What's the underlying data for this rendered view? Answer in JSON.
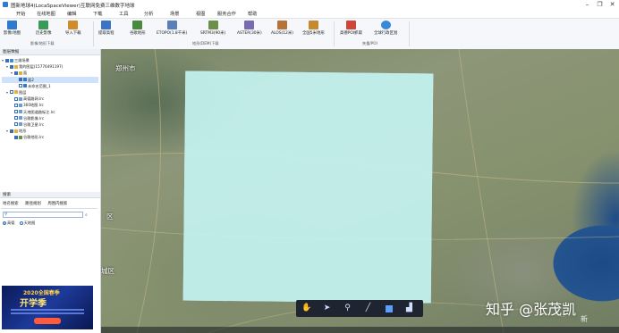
{
  "window": {
    "title": "图新地球4(LocaSpaceViewer)互联网免费三维数字地球",
    "controls": [
      "–",
      "❐",
      "✕"
    ]
  },
  "menu": [
    "开始",
    "在线地图",
    "编辑",
    "下载",
    "工具",
    "分析",
    "场景",
    "视图",
    "服务合作",
    "帮助"
  ],
  "ribbon": {
    "buttons": [
      {
        "label": "影像/地图",
        "icon": "imagery-icon",
        "color": "#2f7ad1"
      },
      {
        "label": "历史影像",
        "icon": "history-imagery-icon",
        "color": "#3a9a57"
      },
      {
        "label": "导入下载",
        "icon": "import-download-icon",
        "color": "#d08b2a"
      },
      {
        "label": "提取高程",
        "icon": "extract-elevation-icon",
        "color": "#3c73c4"
      },
      {
        "label": "谷歌地形",
        "icon": "google-terrain-icon",
        "color": "#4a8a3c"
      },
      {
        "label": "ETOPO(1.8千米)",
        "icon": "etopo-icon",
        "color": "#5b7fb8"
      },
      {
        "label": "SRTM3(90米)",
        "icon": "srtm3-icon",
        "color": "#6c8f4a"
      },
      {
        "label": "ASTER(30米)",
        "icon": "aster-icon",
        "color": "#7a6bb0"
      },
      {
        "label": "ALOS(12米)",
        "icon": "alos-icon",
        "color": "#b5733a"
      },
      {
        "label": "全国5米地形",
        "icon": "terrain-5m-icon",
        "color": "#c58a2e"
      },
      {
        "label": "高德POI抓取",
        "icon": "amap-poi-icon",
        "color": "#d0453a"
      },
      {
        "label": "全球行政区划",
        "icon": "admin-boundary-icon",
        "color": "#3b88d6"
      }
    ],
    "groups": [
      "影像/地形下载",
      "地形(DEM)下载",
      "矢量/POI"
    ]
  },
  "layers_panel": {
    "title": "图层数据",
    "rows": [
      {
        "label": "三维场景",
        "level": 0,
        "checked": true,
        "toggle": "▾"
      },
      {
        "label": "我的图层(15776491197)",
        "level": 1,
        "checked": true,
        "toggle": "▾"
      },
      {
        "label": "面",
        "level": 2,
        "checked": true,
        "toggle": "▾"
      },
      {
        "label": "面2",
        "level": 3,
        "checked": true,
        "toggle": "",
        "selected": true
      },
      {
        "label": "未命名范围_1",
        "level": 3,
        "checked": false,
        "toggle": ""
      },
      {
        "label": "图层",
        "level": 1,
        "checked": false,
        "toggle": "▾"
      },
      {
        "label": "高德路网.lrc",
        "level": 2,
        "checked": false,
        "toggle": ""
      },
      {
        "label": "360地图.lrc",
        "level": 2,
        "checked": false,
        "toggle": ""
      },
      {
        "label": "天地图道路标注.lrc",
        "level": 2,
        "checked": false,
        "toggle": ""
      },
      {
        "label": "谷歌影像.lrc",
        "level": 2,
        "checked": false,
        "toggle": ""
      },
      {
        "label": "谷歌卫星.lrc",
        "level": 2,
        "checked": false,
        "toggle": ""
      },
      {
        "label": "地形",
        "level": 1,
        "checked": true,
        "toggle": "▾"
      },
      {
        "label": "谷歌地形.lrc",
        "level": 2,
        "checked": true,
        "toggle": ""
      }
    ]
  },
  "search_panel": {
    "title": "搜索",
    "tabs": [
      "地名搜索",
      "路径规划",
      "周围内搜索"
    ],
    "placeholder": "",
    "radios": [
      {
        "label": "高德",
        "on": true
      },
      {
        "label": "天地图",
        "on": false
      }
    ]
  },
  "ad": {
    "line1": "2020全国春季",
    "line2": "开学季"
  },
  "map": {
    "labels": [
      {
        "text": "郑州市",
        "name": "map-label-city-1"
      },
      {
        "text": "区",
        "name": "map-label-district-1"
      },
      {
        "text": "城区",
        "name": "map-label-district-2"
      }
    ],
    "watermark": "知乎 @张茂凯",
    "watermark_sub": "新",
    "toolbar_icons": [
      "pan-hand-icon",
      "select-arrow-icon",
      "placemark-icon",
      "line-draw-icon",
      "polygon-draw-icon",
      "chart-icon"
    ]
  }
}
